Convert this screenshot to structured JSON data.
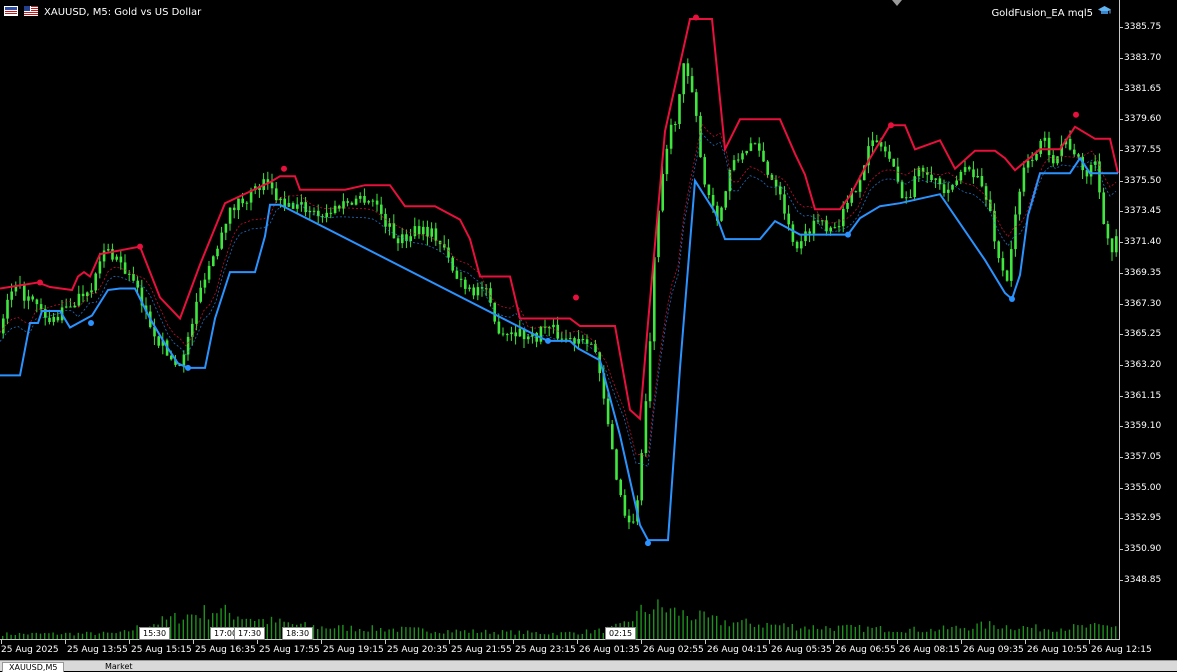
{
  "window": {
    "symbol_title": "XAUUSD, M5:  Gold vs US Dollar",
    "ea_label": "GoldFusion_EA mql5",
    "icons": [
      "chart-window-icon",
      "symbol-flag-icon",
      "ea-hat-icon"
    ]
  },
  "tabs": {
    "active": "XAUUSD,M5",
    "second": "Market"
  },
  "colors": {
    "background": "#000000",
    "candle": "#3ee63e",
    "volume": "#1f8f1f",
    "upper_band": "#e8103c",
    "lower_band": "#2b93ff",
    "axis_text": "#ffffff"
  },
  "chart_data": {
    "type": "candlestick",
    "timeframe": "M5",
    "symbol": "XAUUSD",
    "y_ticks": [
      "3385.75",
      "3383.70",
      "3381.65",
      "3379.60",
      "3377.55",
      "3375.50",
      "3373.45",
      "3371.40",
      "3369.35",
      "3367.30",
      "3365.25",
      "3363.20",
      "3361.15",
      "3359.10",
      "3357.05",
      "3355.00",
      "3352.95",
      "3350.90",
      "3348.85"
    ],
    "ylim": [
      3347.5,
      3387.0
    ],
    "x_ticks": [
      "25 Aug 2025",
      "25 Aug 13:55",
      "25 Aug 15:15",
      "25 Aug 16:35",
      "25 Aug 17:55",
      "25 Aug 19:15",
      "25 Aug 20:35",
      "25 Aug 21:55",
      "25 Aug 23:15",
      "26 Aug 01:35",
      "26 Aug 02:55",
      "26 Aug 04:15",
      "26 Aug 05:35",
      "26 Aug 06:55",
      "26 Aug 08:15",
      "26 Aug 09:35",
      "26 Aug 10:55",
      "26 Aug 12:15"
    ],
    "time_markers": [
      "15:30",
      "17:00",
      "17:30",
      "18:30",
      "02:15"
    ],
    "price_path": [
      [
        0,
        3365.3
      ],
      [
        10,
        3367.8
      ],
      [
        20,
        3368.2
      ],
      [
        35,
        3367.2
      ],
      [
        50,
        3366.0
      ],
      [
        65,
        3366.8
      ],
      [
        80,
        3367.8
      ],
      [
        95,
        3368.8
      ],
      [
        105,
        3370.8
      ],
      [
        115,
        3370.6
      ],
      [
        125,
        3369.6
      ],
      [
        135,
        3368.6
      ],
      [
        145,
        3366.8
      ],
      [
        160,
        3364.8
      ],
      [
        175,
        3363.3
      ],
      [
        185,
        3363.8
      ],
      [
        195,
        3366.6
      ],
      [
        205,
        3369.2
      ],
      [
        215,
        3370.6
      ],
      [
        225,
        3372.9
      ],
      [
        240,
        3374.1
      ],
      [
        255,
        3374.8
      ],
      [
        265,
        3375.3
      ],
      [
        275,
        3374.6
      ],
      [
        285,
        3373.6
      ],
      [
        295,
        3373.9
      ],
      [
        310,
        3373.6
      ],
      [
        325,
        3373.2
      ],
      [
        340,
        3373.9
      ],
      [
        355,
        3374.3
      ],
      [
        365,
        3374.4
      ],
      [
        375,
        3374.2
      ],
      [
        385,
        3372.9
      ],
      [
        395,
        3371.8
      ],
      [
        405,
        3371.5
      ],
      [
        415,
        3372.4
      ],
      [
        425,
        3372.3
      ],
      [
        435,
        3371.9
      ],
      [
        445,
        3370.9
      ],
      [
        455,
        3369.1
      ],
      [
        465,
        3368.7
      ],
      [
        475,
        3368.2
      ],
      [
        485,
        3368.4
      ],
      [
        495,
        3366.0
      ],
      [
        505,
        3365.4
      ],
      [
        515,
        3365.6
      ],
      [
        525,
        3365.2
      ],
      [
        535,
        3365.0
      ],
      [
        545,
        3365.8
      ],
      [
        555,
        3365.4
      ],
      [
        565,
        3365.0
      ],
      [
        575,
        3364.9
      ],
      [
        585,
        3365.3
      ],
      [
        595,
        3364.4
      ],
      [
        605,
        3360.6
      ],
      [
        615,
        3356.6
      ],
      [
        625,
        3353.3
      ],
      [
        635,
        3352.5
      ],
      [
        640,
        3355.4
      ],
      [
        648,
        3361.5
      ],
      [
        655,
        3370.0
      ],
      [
        662,
        3375.2
      ],
      [
        670,
        3378.7
      ],
      [
        677,
        3379.9
      ],
      [
        685,
        3383.2
      ],
      [
        690,
        3382.0
      ],
      [
        697,
        3379.6
      ],
      [
        705,
        3375.5
      ],
      [
        712,
        3374.2
      ],
      [
        720,
        3372.9
      ],
      [
        730,
        3376.0
      ],
      [
        740,
        3377.1
      ],
      [
        750,
        3378.0
      ],
      [
        760,
        3377.3
      ],
      [
        770,
        3375.9
      ],
      [
        780,
        3375.2
      ],
      [
        790,
        3372.2
      ],
      [
        800,
        3370.9
      ],
      [
        810,
        3372.4
      ],
      [
        820,
        3373.0
      ],
      [
        830,
        3372.4
      ],
      [
        840,
        3372.9
      ],
      [
        850,
        3374.0
      ],
      [
        860,
        3375.8
      ],
      [
        870,
        3377.8
      ],
      [
        880,
        3378.1
      ],
      [
        890,
        3377.0
      ],
      [
        900,
        3375.0
      ],
      [
        910,
        3374.2
      ],
      [
        920,
        3376.6
      ],
      [
        930,
        3376.2
      ],
      [
        940,
        3375.2
      ],
      [
        950,
        3374.4
      ],
      [
        960,
        3375.9
      ],
      [
        970,
        3376.6
      ],
      [
        980,
        3375.5
      ],
      [
        990,
        3373.7
      ],
      [
        1000,
        3370.0
      ],
      [
        1008,
        3369.0
      ],
      [
        1015,
        3372.5
      ],
      [
        1025,
        3376.3
      ],
      [
        1035,
        3377.4
      ],
      [
        1045,
        3378.1
      ],
      [
        1055,
        3377.0
      ],
      [
        1065,
        3378.3
      ],
      [
        1075,
        3377.5
      ],
      [
        1085,
        3375.6
      ],
      [
        1095,
        3377.1
      ],
      [
        1105,
        3372.8
      ],
      [
        1112,
        3370.6
      ],
      [
        1118,
        3371.6
      ]
    ],
    "upper_band": [
      [
        0,
        3368.3
      ],
      [
        38,
        3368.7
      ],
      [
        50,
        3368.4
      ],
      [
        72,
        3368.2
      ],
      [
        78,
        3369.1
      ],
      [
        84,
        3369.4
      ],
      [
        90,
        3369.1
      ],
      [
        100,
        3370.6
      ],
      [
        140,
        3371.1
      ],
      [
        160,
        3367.7
      ],
      [
        180,
        3366.3
      ],
      [
        200,
        3369.9
      ],
      [
        225,
        3374.0
      ],
      [
        270,
        3375.4
      ],
      [
        280,
        3375.8
      ],
      [
        295,
        3375.8
      ],
      [
        300,
        3374.9
      ],
      [
        345,
        3374.9
      ],
      [
        365,
        3375.2
      ],
      [
        390,
        3375.2
      ],
      [
        405,
        3373.8
      ],
      [
        435,
        3373.8
      ],
      [
        460,
        3372.9
      ],
      [
        470,
        3371.6
      ],
      [
        480,
        3369.1
      ],
      [
        510,
        3369.1
      ],
      [
        520,
        3366.3
      ],
      [
        570,
        3366.3
      ],
      [
        580,
        3365.8
      ],
      [
        615,
        3365.8
      ],
      [
        630,
        3360.2
      ],
      [
        640,
        3359.6
      ],
      [
        648,
        3366.0
      ],
      [
        665,
        3378.8
      ],
      [
        690,
        3386.3
      ],
      [
        712,
        3386.3
      ],
      [
        725,
        3377.6
      ],
      [
        740,
        3379.6
      ],
      [
        780,
        3379.6
      ],
      [
        795,
        3377.3
      ],
      [
        805,
        3375.9
      ],
      [
        815,
        3373.6
      ],
      [
        840,
        3373.6
      ],
      [
        850,
        3374.5
      ],
      [
        870,
        3377.0
      ],
      [
        890,
        3379.2
      ],
      [
        905,
        3379.2
      ],
      [
        915,
        3377.6
      ],
      [
        940,
        3378.2
      ],
      [
        955,
        3376.3
      ],
      [
        975,
        3377.5
      ],
      [
        995,
        3377.5
      ],
      [
        1005,
        3377.0
      ],
      [
        1015,
        3376.2
      ],
      [
        1040,
        3377.6
      ],
      [
        1060,
        3377.6
      ],
      [
        1075,
        3379.1
      ],
      [
        1095,
        3378.3
      ],
      [
        1110,
        3378.3
      ],
      [
        1118,
        3376.0
      ]
    ],
    "lower_band": [
      [
        0,
        3362.5
      ],
      [
        20,
        3362.5
      ],
      [
        30,
        3366.0
      ],
      [
        38,
        3366.0
      ],
      [
        42,
        3366.8
      ],
      [
        60,
        3366.8
      ],
      [
        70,
        3365.7
      ],
      [
        92,
        3366.5
      ],
      [
        108,
        3368.2
      ],
      [
        120,
        3368.3
      ],
      [
        135,
        3368.3
      ],
      [
        150,
        3366.3
      ],
      [
        165,
        3364.6
      ],
      [
        178,
        3363.3
      ],
      [
        188,
        3363.0
      ],
      [
        205,
        3363.0
      ],
      [
        215,
        3366.3
      ],
      [
        230,
        3369.4
      ],
      [
        255,
        3369.4
      ],
      [
        265,
        3371.8
      ],
      [
        270,
        3373.9
      ],
      [
        280,
        3373.9
      ],
      [
        538,
        3365.1
      ],
      [
        548,
        3364.8
      ],
      [
        570,
        3364.8
      ],
      [
        578,
        3364.3
      ],
      [
        600,
        3363.5
      ],
      [
        620,
        3358.5
      ],
      [
        640,
        3352.5
      ],
      [
        648,
        3351.5
      ],
      [
        668,
        3351.5
      ],
      [
        680,
        3363.0
      ],
      [
        695,
        3375.5
      ],
      [
        715,
        3373.4
      ],
      [
        725,
        3371.6
      ],
      [
        760,
        3371.6
      ],
      [
        775,
        3372.8
      ],
      [
        800,
        3371.9
      ],
      [
        848,
        3371.9
      ],
      [
        860,
        3373.0
      ],
      [
        880,
        3373.8
      ],
      [
        900,
        3374.0
      ],
      [
        940,
        3374.6
      ],
      [
        985,
        3370.2
      ],
      [
        1005,
        3368.0
      ],
      [
        1012,
        3367.6
      ],
      [
        1020,
        3369.2
      ],
      [
        1028,
        3373.2
      ],
      [
        1040,
        3376.0
      ],
      [
        1070,
        3376.0
      ],
      [
        1080,
        3377.0
      ],
      [
        1090,
        3376.0
      ],
      [
        1118,
        3376.0
      ]
    ],
    "signal_dots_upper": [
      [
        40,
        3368.7
      ],
      [
        140,
        3371.1
      ],
      [
        284,
        3376.3
      ],
      [
        576,
        3367.7
      ],
      [
        696,
        3386.4
      ],
      [
        891,
        3379.2
      ],
      [
        1076,
        3379.9
      ]
    ],
    "signal_dots_lower": [
      [
        91,
        3366.0
      ],
      [
        188,
        3363.0
      ],
      [
        548,
        3364.8
      ],
      [
        648,
        3351.3
      ],
      [
        848,
        3371.9
      ],
      [
        1012,
        3367.6
      ]
    ],
    "volume_profile": [
      [
        0,
        0.18
      ],
      [
        120,
        0.2
      ],
      [
        140,
        0.4
      ],
      [
        180,
        0.7
      ],
      [
        215,
        0.9
      ],
      [
        260,
        0.6
      ],
      [
        310,
        0.4
      ],
      [
        360,
        0.35
      ],
      [
        420,
        0.3
      ],
      [
        480,
        0.25
      ],
      [
        560,
        0.2
      ],
      [
        600,
        0.28
      ],
      [
        620,
        0.4
      ],
      [
        640,
        0.85
      ],
      [
        655,
        1.0
      ],
      [
        680,
        0.8
      ],
      [
        720,
        0.55
      ],
      [
        800,
        0.4
      ],
      [
        860,
        0.35
      ],
      [
        930,
        0.3
      ],
      [
        990,
        0.45
      ],
      [
        1040,
        0.35
      ],
      [
        1100,
        0.4
      ],
      [
        1118,
        0.45
      ]
    ]
  }
}
